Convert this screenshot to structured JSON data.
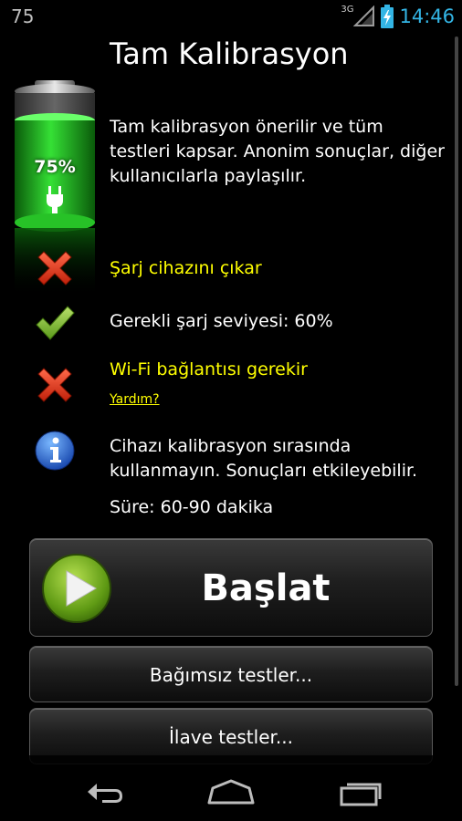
{
  "status_bar": {
    "left_text": "75",
    "network_type": "3G",
    "time": "14:46",
    "clock_color": "#33b5e5"
  },
  "header": {
    "title": "Tam Kalibrasyon",
    "battery_percent": "75%",
    "battery_level": 0.75,
    "battery_icon": "battery-charging-icon",
    "intro_lines": [
      "Tam kalibrasyon önerilir ve tüm",
      "testleri kapsar. Anonim sonuçlar, diğer",
      "kullanıcılarla paylaşılır."
    ]
  },
  "requirements": [
    {
      "icon": "cross-icon",
      "text": "Şarj cihazını çıkar",
      "status": "failed",
      "color": "#ffff00"
    },
    {
      "icon": "check-icon",
      "text": "Gerekli şarj seviyesi: 60%",
      "status": "passed",
      "color": "#ffffff"
    },
    {
      "icon": "cross-icon",
      "text": "Wi-Fi bağlantısı gerekir",
      "status": "failed",
      "color": "#ffff00"
    }
  ],
  "help_link": "Yardım?",
  "info": {
    "icon": "info-icon",
    "lines": [
      "Cihazı kalibrasyon sırasında",
      "kullanmayın. Sonuçları etkileyebilir."
    ],
    "duration": "Süre: 60-90 dakika"
  },
  "buttons": {
    "start": "Başlat",
    "independent_tests": "Bağımsız testler...",
    "extra_tests": "İlave testler..."
  },
  "nav": {
    "back_icon": "back-icon",
    "home_icon": "home-icon",
    "recent_icon": "recent-apps-icon"
  }
}
